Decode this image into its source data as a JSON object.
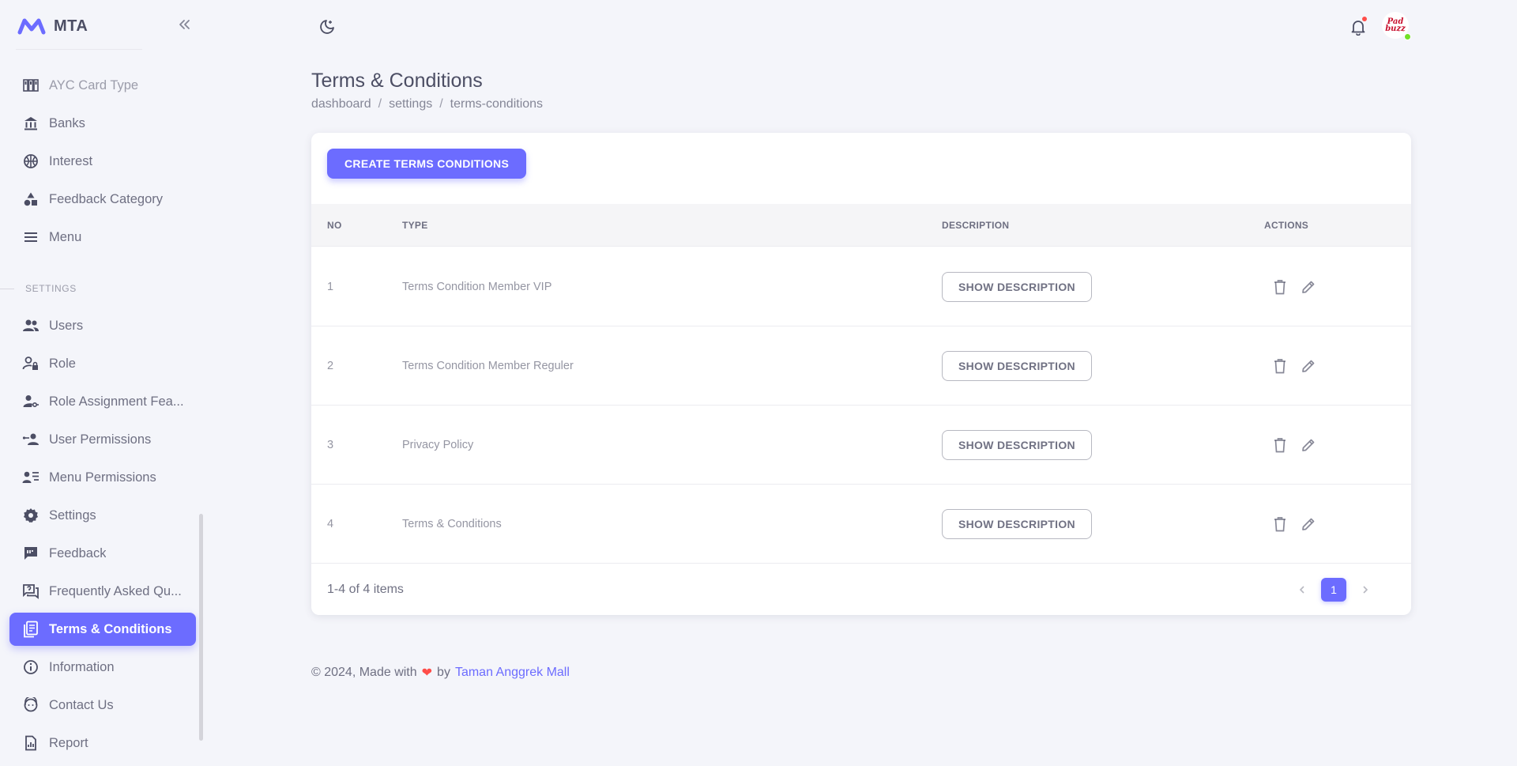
{
  "brand": {
    "name": "MTA"
  },
  "colors": {
    "primary": "#6c6cff",
    "text": "#4c4e64",
    "heart": "#ff4d49",
    "online": "#72e128"
  },
  "sidebar": {
    "items_top": [
      {
        "label": "AYC Card Type",
        "icon": "card-type-icon"
      },
      {
        "label": "Banks",
        "icon": "bank-icon"
      },
      {
        "label": "Interest",
        "icon": "basketball-icon"
      },
      {
        "label": "Feedback Category",
        "icon": "shapes-icon"
      },
      {
        "label": "Menu",
        "icon": "menu-icon"
      }
    ],
    "section_title": "SETTINGS",
    "items_settings": [
      {
        "label": "Users",
        "icon": "users-icon"
      },
      {
        "label": "Role",
        "icon": "user-lock-icon"
      },
      {
        "label": "Role Assignment Fea...",
        "icon": "user-key-icon"
      },
      {
        "label": "User Permissions",
        "icon": "user-share-icon"
      },
      {
        "label": "Menu Permissions",
        "icon": "user-list-icon"
      },
      {
        "label": "Settings",
        "icon": "gear-icon"
      },
      {
        "label": "Feedback",
        "icon": "feedback-icon"
      },
      {
        "label": "Frequently Asked Qu...",
        "icon": "faq-icon"
      },
      {
        "label": "Terms & Conditions",
        "icon": "document-icon",
        "active": true
      },
      {
        "label": "Information",
        "icon": "info-icon"
      },
      {
        "label": "Contact Us",
        "icon": "support-agent-icon"
      },
      {
        "label": "Report",
        "icon": "report-icon"
      }
    ]
  },
  "header": {
    "title": "Terms & Conditions",
    "breadcrumb": [
      "dashboard",
      "settings",
      "terms-conditions"
    ],
    "avatar_text": "Pad buzz"
  },
  "card": {
    "create_button": "CREATE TERMS CONDITIONS",
    "columns": [
      "NO",
      "TYPE",
      "DESCRIPTION",
      "ACTIONS"
    ],
    "rows": [
      {
        "no": "1",
        "type": "Terms Condition Member VIP",
        "desc_button": "SHOW DESCRIPTION"
      },
      {
        "no": "2",
        "type": "Terms Condition Member Reguler",
        "desc_button": "SHOW DESCRIPTION"
      },
      {
        "no": "3",
        "type": "Privacy Policy",
        "desc_button": "SHOW DESCRIPTION"
      },
      {
        "no": "4",
        "type": "Terms & Conditions",
        "desc_button": "SHOW DESCRIPTION"
      }
    ],
    "items_count": "1-4 of 4 items",
    "current_page": "1"
  },
  "footer": {
    "prefix": "© 2024, Made with",
    "heart": "❤",
    "by": "by",
    "link": "Taman Anggrek Mall"
  }
}
